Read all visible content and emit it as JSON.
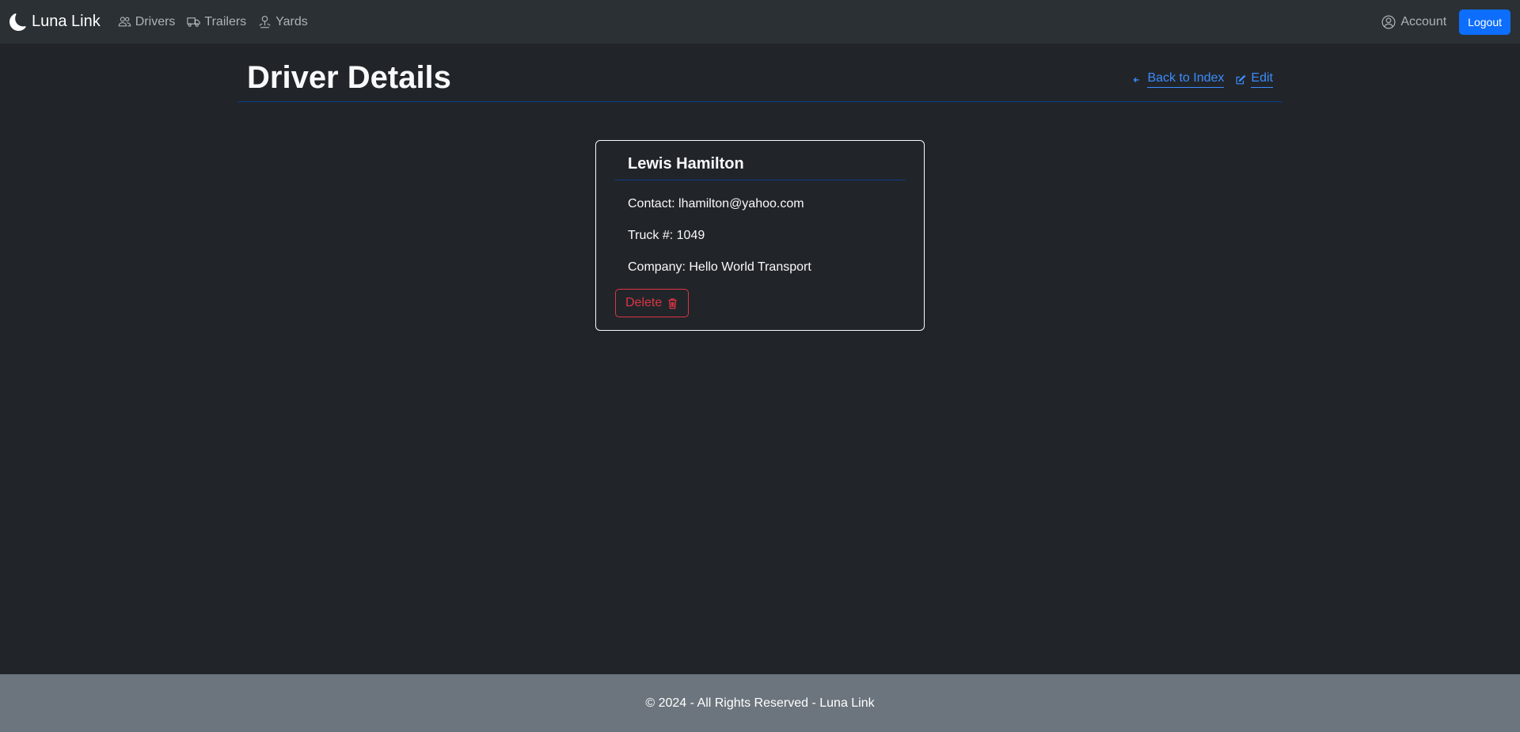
{
  "nav": {
    "brand": "Luna Link",
    "brand_icon": "moon-icon",
    "links": [
      {
        "label": "Drivers",
        "icon": "people-icon"
      },
      {
        "label": "Trailers",
        "icon": "truck-icon"
      },
      {
        "label": "Yards",
        "icon": "person-pin-icon"
      }
    ],
    "account_label": "Account",
    "logout_label": "Logout"
  },
  "header": {
    "title": "Driver Details",
    "back_label": "Back to Index",
    "edit_label": "Edit"
  },
  "driver": {
    "name": "Lewis Hamilton",
    "contact": "Contact: lhamilton@yahoo.com",
    "truck": "Truck #: 1049",
    "company": "Company: Hello World Transport",
    "delete_label": "Delete"
  },
  "footer": {
    "text": "© 2024 - All Rights Reserved - Luna Link"
  },
  "colors": {
    "background": "#212529",
    "navbar": "#2b3035",
    "primary": "#0d6efd",
    "link": "#3d8bfd",
    "danger": "#dc3545",
    "footer": "#6c757d"
  }
}
